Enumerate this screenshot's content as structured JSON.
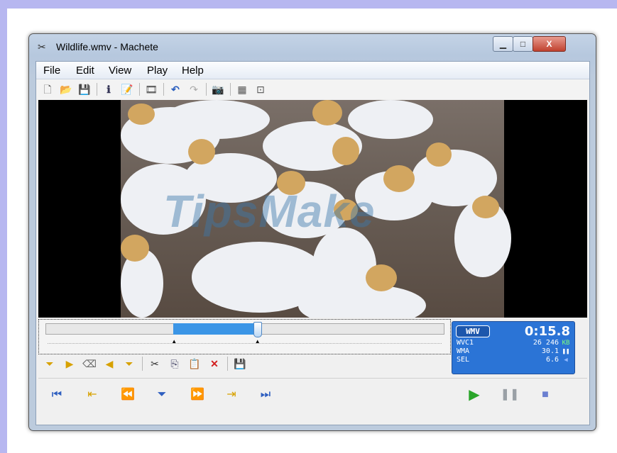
{
  "window": {
    "title": "Wildlife.wmv - Machete",
    "app_icon": "machete-app-icon",
    "caption_buttons": {
      "minimize": "▁",
      "maximize": "□",
      "close": "X"
    }
  },
  "menu": [
    "File",
    "Edit",
    "View",
    "Play",
    "Help"
  ],
  "toolbar": {
    "icons": [
      "new-icon",
      "open-icon",
      "save-icon",
      "info-icon",
      "properties-icon",
      "film-icon",
      "undo-icon",
      "redo-icon",
      "snapshot-icon",
      "frame-icon",
      "cut-frame-icon"
    ],
    "glyphs": {
      "new": "🗋",
      "open": "📂",
      "save": "💾",
      "info": "ℹ",
      "properties": "📝",
      "film": "🎞",
      "undo": "↶",
      "redo": "↷",
      "snapshot": "📷",
      "frame": "▦",
      "cut_frame": "⊡"
    }
  },
  "video": {
    "watermark": "TipsMake"
  },
  "timeline": {
    "selection_start_fraction": 0.32,
    "selection_end_fraction": 0.53,
    "playhead_fraction": 0.53
  },
  "status_panel": {
    "format_badge": "WMV",
    "time": "0:15.8",
    "rows": [
      {
        "label": "WVC1",
        "value": "26 246",
        "unit": "KB",
        "unit_color": "#7dff7d"
      },
      {
        "label": "WMA",
        "value": "30.1",
        "unit": "❚❚",
        "unit_color": "#ffffff"
      },
      {
        "label": "SEL",
        "value": "6.6",
        "unit": "◀",
        "unit_color": "#8fb8ff"
      }
    ]
  },
  "edit_toolbar": {
    "glyphs": {
      "mark_in": "⏷",
      "select_in": "▶",
      "erase": "⌫",
      "select_out": "◀",
      "mark_out": "⏷",
      "cut": "✂",
      "copy": "⎘",
      "paste": "📋",
      "delete": "✕",
      "save": "💾"
    }
  },
  "transport": {
    "glyphs": {
      "go_start": "⏮",
      "prev_mark": "⇤",
      "rewind": "⏪",
      "step": "⏷",
      "forward": "⏩",
      "next_mark": "⇥",
      "go_end": "⏭",
      "play": "▶",
      "pause": "❚❚",
      "stop": "■"
    },
    "colors": {
      "play": "#2aa52a",
      "pause": "#9aa0a6",
      "stop": "#6a7fd0",
      "nav": "#2f5fc0",
      "mark": "#d7a100"
    }
  }
}
